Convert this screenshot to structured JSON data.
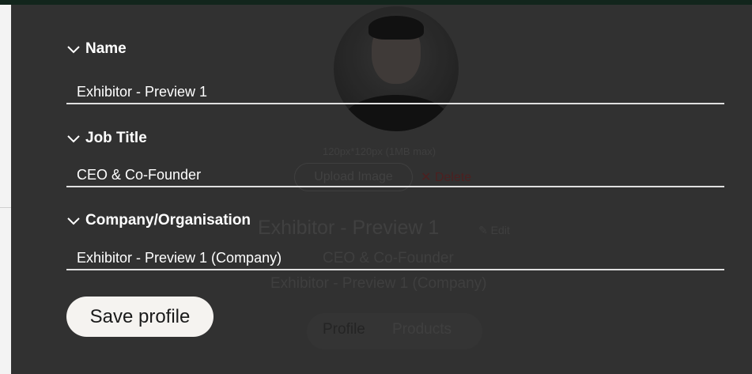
{
  "background_profile": {
    "image_hint": "120px*120px (1MB max)",
    "upload_label": "Upload Image",
    "delete_label": "✕ Delete",
    "name": "Exhibitor - Preview 1",
    "edit_label": "✎ Edit",
    "job_title": "CEO & Co-Founder",
    "company": "Exhibitor - Preview 1 (Company)",
    "tabs": [
      {
        "label": "Profile"
      },
      {
        "label": "Products"
      }
    ]
  },
  "form": {
    "fields": [
      {
        "label": "Name",
        "value": "Exhibitor - Preview 1"
      },
      {
        "label": "Job Title",
        "value": "CEO & Co-Founder"
      },
      {
        "label": "Company/Organisation",
        "value": "Exhibitor - Preview 1 (Company)"
      }
    ],
    "save_label": "Save profile"
  },
  "colors": {
    "overlay_bg": "#3a3a3a",
    "top_strip": "#12251c",
    "text": "#ffffff",
    "button_bg": "#f5f3f0"
  },
  "icons": {
    "field_toggle": "chevron-down-icon"
  }
}
